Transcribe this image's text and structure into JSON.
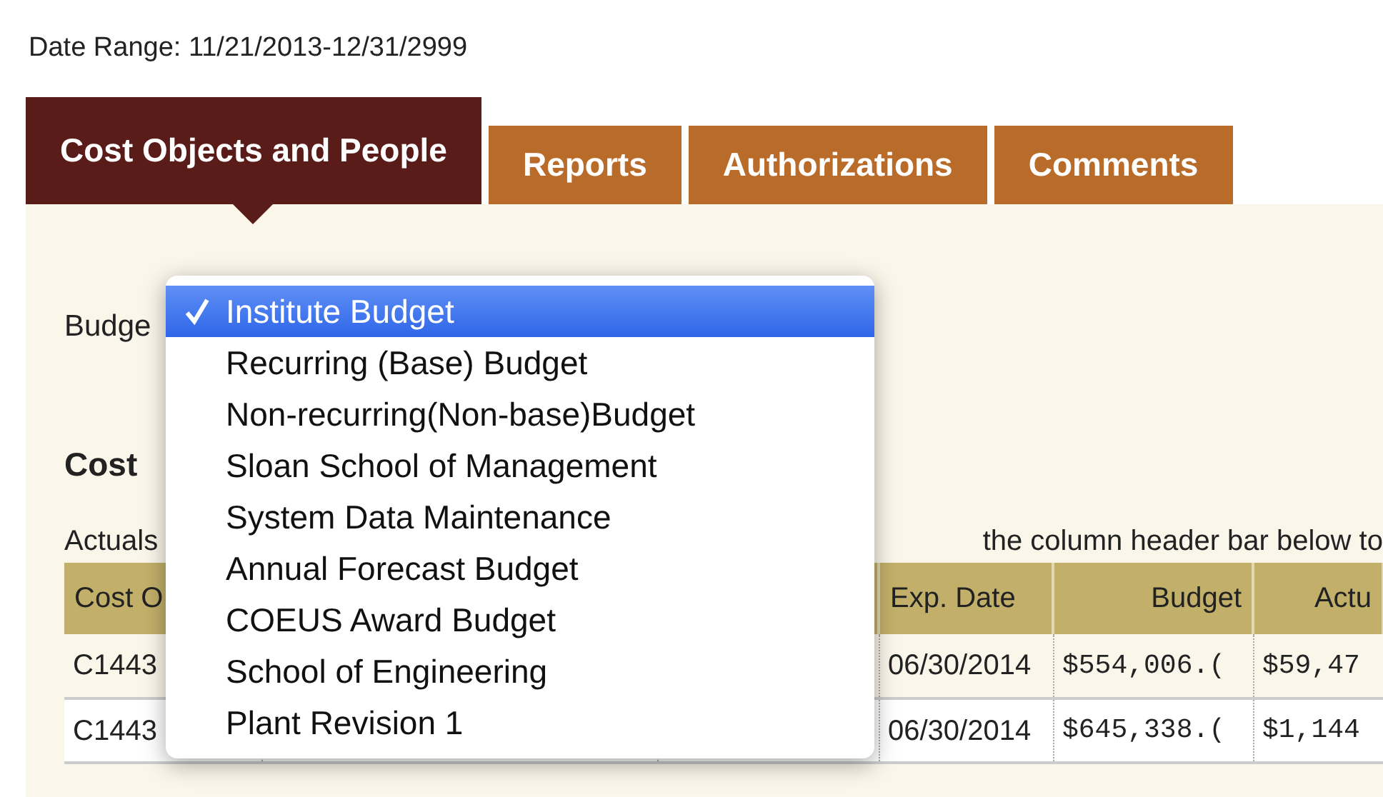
{
  "date_range": "Date Range: 11/21/2013-12/31/2999",
  "tabs": [
    {
      "label": "Cost Objects and People",
      "selected": true
    },
    {
      "label": "Reports",
      "selected": false
    },
    {
      "label": "Authorizations",
      "selected": false
    },
    {
      "label": "Comments",
      "selected": false
    }
  ],
  "budget_label": "Budge",
  "section_title": "Cost",
  "note_left": "Actuals",
  "note_right": "the column header bar below to",
  "table": {
    "columns": [
      "Cost O",
      "",
      "",
      "Exp. Date",
      "Budget",
      "Actu"
    ],
    "rows": [
      [
        "C1443",
        "",
        "",
        "06/30/2014",
        "$554,006.(",
        "$59,47"
      ],
      [
        "C1443",
        "",
        "",
        "06/30/2014",
        "$645,338.(",
        "$1,144"
      ]
    ]
  },
  "budget_menu": [
    {
      "label": "Institute Budget",
      "selected": true
    },
    {
      "label": "Recurring (Base) Budget",
      "selected": false
    },
    {
      "label": "Non-recurring(Non-base)Budget",
      "selected": false
    },
    {
      "label": "Sloan School of Management",
      "selected": false
    },
    {
      "label": "System Data Maintenance",
      "selected": false
    },
    {
      "label": "Annual Forecast Budget",
      "selected": false
    },
    {
      "label": "COEUS Award Budget",
      "selected": false
    },
    {
      "label": "School of Engineering",
      "selected": false
    },
    {
      "label": "Plant Revision 1",
      "selected": false
    }
  ]
}
